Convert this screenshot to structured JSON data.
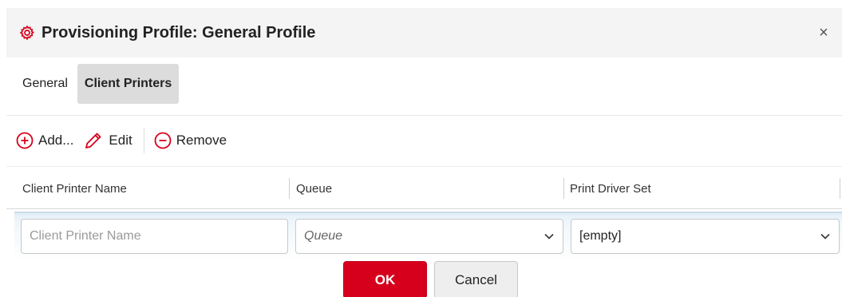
{
  "dialog": {
    "title": "Provisioning Profile: General Profile",
    "title_icon": "gear-icon",
    "close_label": "×"
  },
  "tabs": [
    {
      "label": "General",
      "active": false
    },
    {
      "label": "Client Printers",
      "active": true
    }
  ],
  "toolbar": {
    "add_label": "Add...",
    "edit_label": "Edit",
    "remove_label": "Remove"
  },
  "table": {
    "columns": [
      "Client Printer Name",
      "Queue",
      "Print Driver Set"
    ]
  },
  "edit_row": {
    "name_placeholder": "Client Printer Name",
    "name_value": "",
    "queue_placeholder": "Queue",
    "driver_set_value": "[empty]",
    "ok_label": "OK",
    "cancel_label": "Cancel"
  },
  "colors": {
    "accent": "#d6001c",
    "header_bg": "#f4f4f4",
    "active_tab_bg": "#dcdcdc",
    "edit_row_tint": "#e1eef7"
  }
}
